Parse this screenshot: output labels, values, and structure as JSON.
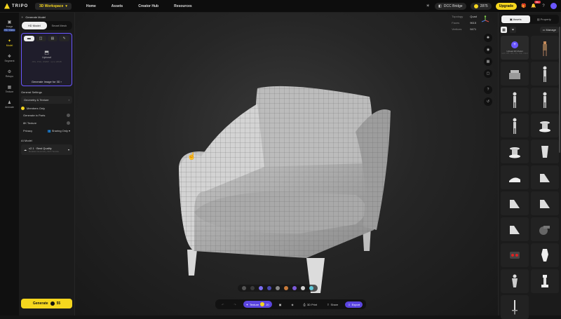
{
  "app": {
    "name": "TRIPO",
    "workspace": "3D Workspace"
  },
  "nav": [
    "Home",
    "Assets",
    "Creator Hub",
    "Resources"
  ],
  "topright": {
    "bridge": "DCC Bridge",
    "credits": "2875",
    "upgrade": "Upgrade",
    "notif_badge": "99+"
  },
  "rail": [
    {
      "label": "Image",
      "sub": "HD Video",
      "icon": "image-icon"
    },
    {
      "label": "Model",
      "icon": "model-icon",
      "active": true
    },
    {
      "label": "Segment",
      "icon": "segment-icon"
    },
    {
      "label": "Retopo",
      "icon": "retopo-icon"
    },
    {
      "label": "Texture",
      "icon": "texture-icon"
    },
    {
      "label": "Animate",
      "icon": "animate-icon"
    }
  ],
  "panel": {
    "generate_model": "Generate Model",
    "tabs": [
      "HD Model",
      "Smart Mesh"
    ],
    "upload": "Upload",
    "upload_hint": "JPG, PNG, WEBP · up to 20MB",
    "generate_image": "Generate Image for 3D",
    "general_settings": "General Settings",
    "geometry": "Geometry & Texture",
    "members_only": "Members Only",
    "generate_in_parts": "Generate in Parts",
    "texture_8k": "8K Texture",
    "privacy": "Privacy",
    "privacy_value": "Sharing Only",
    "ai_model": "AI Model",
    "model_name": "v2.1 · Best Quality",
    "model_sub": "Detailed Geometry, Rich Texture",
    "generate": "Generate",
    "generate_cost": "55"
  },
  "stats": {
    "topology_label": "Topology",
    "topology": "Quad",
    "faces_label": "Faces",
    "faces": "9615",
    "vertices_label": "Vertices",
    "vertices": "9471"
  },
  "bottom": {
    "texture": "Texture",
    "texture_cost": "20",
    "print": "3D Print",
    "share": "Share",
    "export": "Export"
  },
  "swatch_colors": [
    "#555555",
    "#3a3a3a",
    "#7a6cf0",
    "#4a4ab0",
    "#888888",
    "#c87a3a",
    "#7c5ad8",
    "#cfcfcf",
    "#5ec8d8"
  ],
  "rpanel": {
    "tabs": [
      "Assets",
      "Property"
    ],
    "manage": "Manage",
    "upload": "Upload 3D Model",
    "upload_sub": "GLB, FBX, OBJ, STL, 3MF, USDZ",
    "items": [
      "human-figure",
      "armchair",
      "mannequin",
      "mannequin",
      "mannequin",
      "mannequin",
      "pedestal",
      "pedestal",
      "vase",
      "cloth",
      "ramp",
      "ramp",
      "ramp",
      "ramp",
      "cannon",
      "robot",
      "vase-white",
      "figurine",
      "chess-piece",
      "sword"
    ]
  }
}
